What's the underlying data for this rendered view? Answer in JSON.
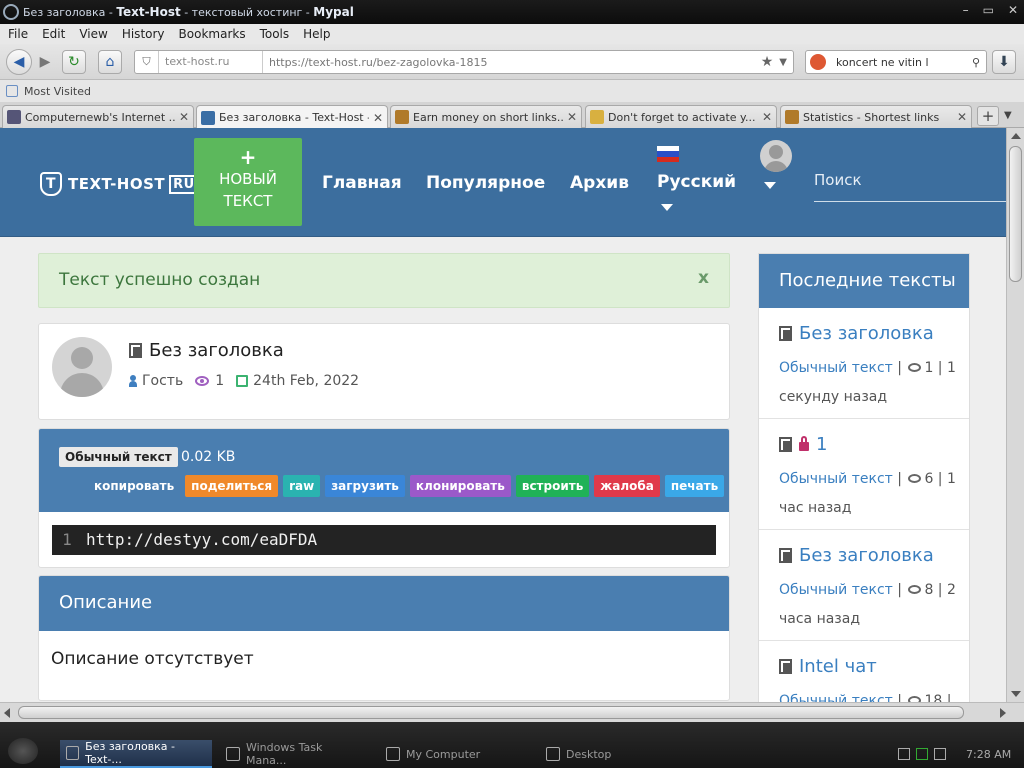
{
  "window": {
    "title_prefix": "Без заголовка - ",
    "title_site": "Text-Host",
    "title_suffix": " - текстовый хостинг - ",
    "title_browser": "Mypal",
    "controls": [
      "–",
      "▭",
      "✕"
    ]
  },
  "menu": [
    "File",
    "Edit",
    "View",
    "History",
    "Bookmarks",
    "Tools",
    "Help"
  ],
  "navbar": {
    "site_label": "text-host.ru",
    "url": "https://text-host.ru/bez-zagolovka-1815",
    "search_value": "koncert ne vitin l"
  },
  "bookmarks": {
    "most_visited": "Most Visited"
  },
  "tabs": [
    {
      "label": "Computernewb's Internet ...",
      "color": "#557"
    },
    {
      "label": "Без заголовка - Text-Host -...",
      "color": "#3a6ea5"
    },
    {
      "label": "Earn money on short links...",
      "color": "#b07a2a"
    },
    {
      "label": "Don't forget to activate y...",
      "color": "#d8b040"
    },
    {
      "label": "Statistics - Shortest links",
      "color": "#b07a2a"
    }
  ],
  "site": {
    "logo_text": "TEXT-HOST",
    "logo_ru": "RU",
    "new_text_plus": "+",
    "new_text_line1": "НОВЫЙ",
    "new_text_line2": "ТЕКСТ",
    "nav": [
      "Главная",
      "Популярное",
      "Архив"
    ],
    "language": "Русский",
    "search_placeholder": "Поиск"
  },
  "alert": {
    "text": "Текст успешно создан",
    "close": "x"
  },
  "paste": {
    "title": "Без заголовка",
    "author": "Гость",
    "views": "1",
    "date": "24th Feb, 2022",
    "syntax": "Обычный текст",
    "size": "0.02 KB",
    "actions": [
      {
        "label": "копировать",
        "color": "#4a7eb0"
      },
      {
        "label": "поделиться",
        "color": "#f0892a"
      },
      {
        "label": "raw",
        "color": "#2ab3b0"
      },
      {
        "label": "загрузить",
        "color": "#3a86d8"
      },
      {
        "label": "клонировать",
        "color": "#9b59c9"
      },
      {
        "label": "встроить",
        "color": "#20b257"
      },
      {
        "label": "жалоба",
        "color": "#e0394a"
      },
      {
        "label": "печать",
        "color": "#3aa8e8"
      }
    ],
    "line_number": "1",
    "code": "http://destyy.com/eaDFDA"
  },
  "description": {
    "heading": "Описание",
    "body": "Описание отсутствует"
  },
  "sidebar": {
    "heading": "Последние тексты",
    "items": [
      {
        "title": "Без заголовка",
        "syntax": "Обычный текст",
        "sep1": " | ",
        "views": "1",
        "sep2": " | 1",
        "time": "секунду назад",
        "locked": false
      },
      {
        "title": "1",
        "syntax": "Обычный текст",
        "sep1": " | ",
        "views": "6",
        "sep2": " | 1",
        "time": "час назад",
        "locked": true
      },
      {
        "title": "Без заголовка",
        "syntax": "Обычный текст",
        "sep1": " | ",
        "views": "8",
        "sep2": " | 2",
        "time": "часа назад",
        "locked": false
      },
      {
        "title": "Intel чат",
        "syntax": "Обычный текст",
        "sep1": " | ",
        "views": "18",
        "sep2": " |",
        "time": "",
        "locked": false
      }
    ]
  },
  "taskbar": {
    "tasks": [
      "Без заголовка - Text-...",
      "Windows Task Mana...",
      "My Computer",
      "Desktop"
    ],
    "clock": "7:28 AM"
  }
}
